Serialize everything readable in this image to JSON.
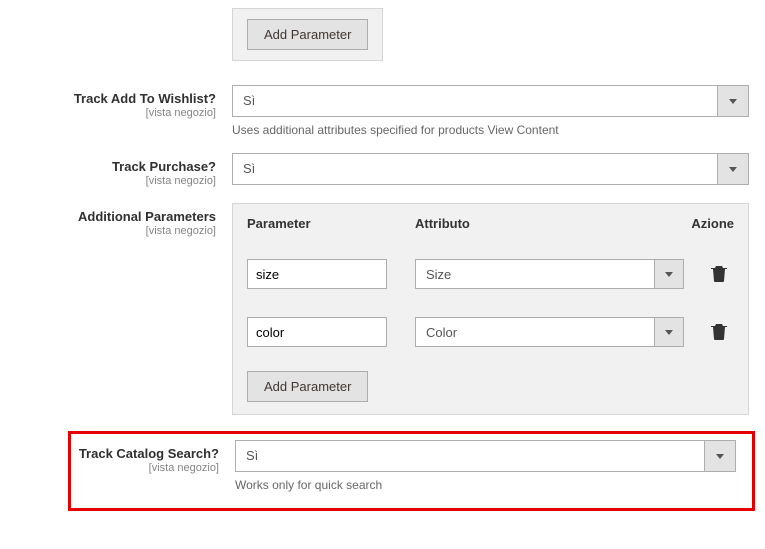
{
  "topButton": {
    "label": "Add Parameter"
  },
  "wishlist": {
    "label": "Track Add To Wishlist?",
    "scope": "[vista negozio]",
    "value": "Sì",
    "help": "Uses additional attributes specified for products View Content"
  },
  "purchase": {
    "label": "Track Purchase?",
    "scope": "[vista negozio]",
    "value": "Sì"
  },
  "additional": {
    "label": "Additional Parameters",
    "scope": "[vista negozio]",
    "headers": {
      "param": "Parameter",
      "attr": "Attributo",
      "action": "Azione"
    },
    "rows": [
      {
        "param": "size",
        "attr": "Size"
      },
      {
        "param": "color",
        "attr": "Color"
      }
    ],
    "addBtn": "Add Parameter"
  },
  "catalogSearch": {
    "label": "Track Catalog Search?",
    "scope": "[vista negozio]",
    "value": "Sì",
    "help": "Works only for quick search"
  }
}
